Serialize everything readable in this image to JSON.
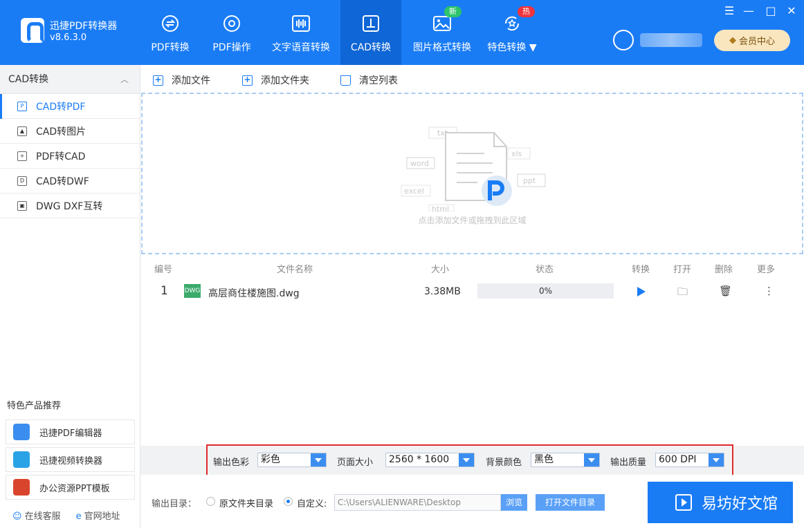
{
  "app": {
    "name": "迅捷PDF转换器",
    "version": "v8.6.3.0"
  },
  "nav": [
    {
      "label": "PDF转换",
      "icon": "pdf-convert-icon"
    },
    {
      "label": "PDF操作",
      "icon": "pdf-operate-icon"
    },
    {
      "label": "文字语音转换",
      "icon": "text-speech-icon"
    },
    {
      "label": "CAD转换",
      "icon": "cad-icon",
      "active": true
    },
    {
      "label": "图片格式转换",
      "icon": "image-icon",
      "badge": "新"
    },
    {
      "label": "特色转换",
      "icon": "special-icon",
      "badge": "热"
    }
  ],
  "member_center": "会员中心",
  "sidebar": {
    "title": "CAD转换",
    "items": [
      {
        "label": "CAD转PDF",
        "active": true
      },
      {
        "label": "CAD转图片"
      },
      {
        "label": "PDF转CAD"
      },
      {
        "label": "CAD转DWF"
      },
      {
        "label": "DWG DXF互转"
      }
    ],
    "featured_title": "特色产品推荐",
    "featured": [
      {
        "label": "迅捷PDF编辑器"
      },
      {
        "label": "迅捷视频转换器"
      },
      {
        "label": "办公资源PPT模板"
      }
    ],
    "links": {
      "service": "在线客服",
      "website": "官网地址"
    }
  },
  "toolbar": {
    "add_file": "添加文件",
    "add_folder": "添加文件夹",
    "clear_list": "清空列表"
  },
  "dropzone": {
    "hint": "点击添加文件或拖拽到此区域",
    "tags": [
      "txt",
      "word",
      "xls",
      "ppt",
      "excel",
      "html"
    ]
  },
  "table": {
    "headers": {
      "no": "编号",
      "name": "文件名称",
      "size": "大小",
      "status": "状态",
      "convert": "转换",
      "open": "打开",
      "delete": "删除",
      "more": "更多"
    },
    "rows": [
      {
        "no": "1",
        "type": "DWG",
        "name": "高层商住楼施图.dwg",
        "size": "3.38MB",
        "progress": "0%"
      }
    ]
  },
  "options": {
    "color_label": "输出色彩",
    "color_value": "彩色",
    "page_label": "页面大小",
    "page_value": "2560 * 1600",
    "bg_label": "背景颜色",
    "bg_value": "黑色",
    "quality_label": "输出质量",
    "quality_value": "600 DPI"
  },
  "output": {
    "label": "输出目录：",
    "original_folder": "原文件夹目录",
    "custom": "自定义:",
    "path": "C:\\Users\\ALIENWARE\\Desktop",
    "browse": "浏览",
    "open_dir": "打开文件目录",
    "convert": "易坊好文馆"
  },
  "colors": {
    "primary": "#1a7cf5",
    "nav_active": "#0f66d6",
    "highlight_box": "#e02b2b"
  }
}
